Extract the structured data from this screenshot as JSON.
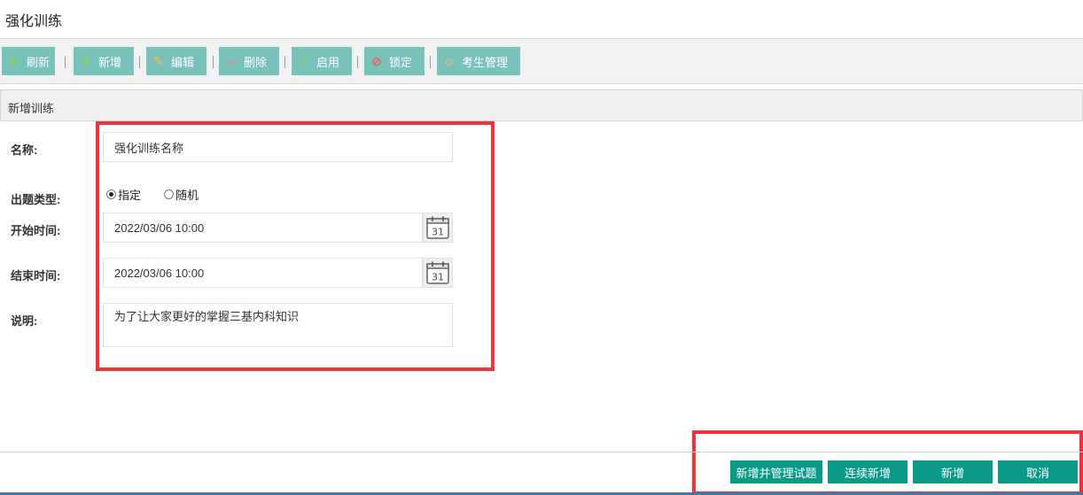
{
  "page": {
    "title": "强化训练"
  },
  "toolbar": {
    "buttons": [
      {
        "label": "刷新",
        "icon": "refresh-icon",
        "glyph": "↻",
        "color": "#8fd14f"
      },
      {
        "label": "新增",
        "icon": "plus-icon",
        "glyph": "+",
        "color": "#8fd14f"
      },
      {
        "label": "编辑",
        "icon": "pencil-icon",
        "glyph": "✎",
        "color": "#f6c343"
      },
      {
        "label": "删除",
        "icon": "minus-icon",
        "glyph": "—",
        "color": "#f28b6c"
      },
      {
        "label": "启用",
        "icon": "check-icon",
        "glyph": "✓",
        "color": "#8fd14f"
      },
      {
        "label": "锁定",
        "icon": "forbidden-icon",
        "glyph": "⊘",
        "color": "#f05a4a"
      },
      {
        "label": "考生管理",
        "icon": "user-icon",
        "glyph": "☺",
        "color": "#f0c070"
      }
    ]
  },
  "section": {
    "title": "新增训练"
  },
  "form": {
    "name": {
      "label": "名称:",
      "value": "强化训练名称"
    },
    "type": {
      "label": "出题类型:",
      "options": [
        "指定",
        "随机"
      ],
      "selected": "指定"
    },
    "start": {
      "label": "开始时间:",
      "value": "2022/03/06 10:00",
      "calendar_day": "31"
    },
    "end": {
      "label": "结束时间:",
      "value": "2022/03/06 10:00",
      "calendar_day": "31"
    },
    "desc": {
      "label": "说明:",
      "value": "为了让大家更好的掌握三基内科知识"
    }
  },
  "footer": {
    "buttons": [
      "新增并管理试题",
      "连续新增",
      "新增",
      "取消"
    ]
  },
  "colors": {
    "toolbar_button": "#79c2bb",
    "footer_button": "#0a9a88",
    "highlight_frame": "#f0333a"
  }
}
